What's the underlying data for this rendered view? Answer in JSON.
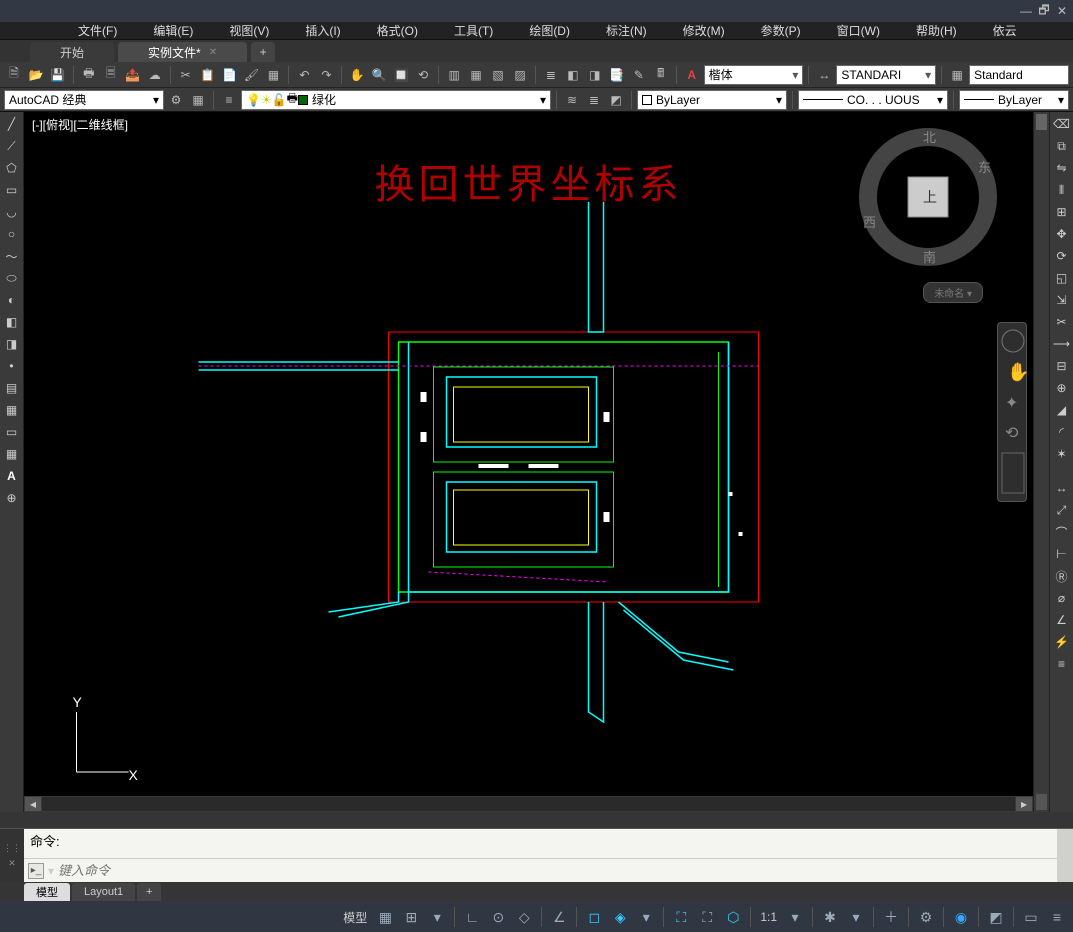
{
  "menus": [
    "文件(F)",
    "编辑(E)",
    "视图(V)",
    "插入(I)",
    "格式(O)",
    "工具(T)",
    "绘图(D)",
    "标注(N)",
    "修改(M)",
    "参数(P)",
    "窗口(W)",
    "帮助(H)",
    "依云"
  ],
  "tabs": {
    "start": "开始",
    "active": "实例文件*"
  },
  "toolbar1": {
    "font": "楷体",
    "anchor": "A",
    "style1": "STANDARI",
    "style2": "Standard"
  },
  "layerRow": {
    "workspace": "AutoCAD 经典",
    "layer": "绿化",
    "linecolor": "ByLayer",
    "linetype": "CO. . . UOUS",
    "lineweight": "ByLayer"
  },
  "viewport": {
    "label": "[-][俯视][二维线框]",
    "annot": "换回世界坐标系",
    "axis_x": "X",
    "axis_y": "Y",
    "cube": {
      "n": "北",
      "e": "东",
      "s": "南",
      "w": "西",
      "top": "上"
    },
    "unnamed": "未命名"
  },
  "cmd": {
    "hist": "命令:",
    "placeholder": "键入命令"
  },
  "layoutTabs": {
    "model": "模型",
    "layout1": "Layout1"
  },
  "status": {
    "model": "模型",
    "scale": "1:1"
  }
}
